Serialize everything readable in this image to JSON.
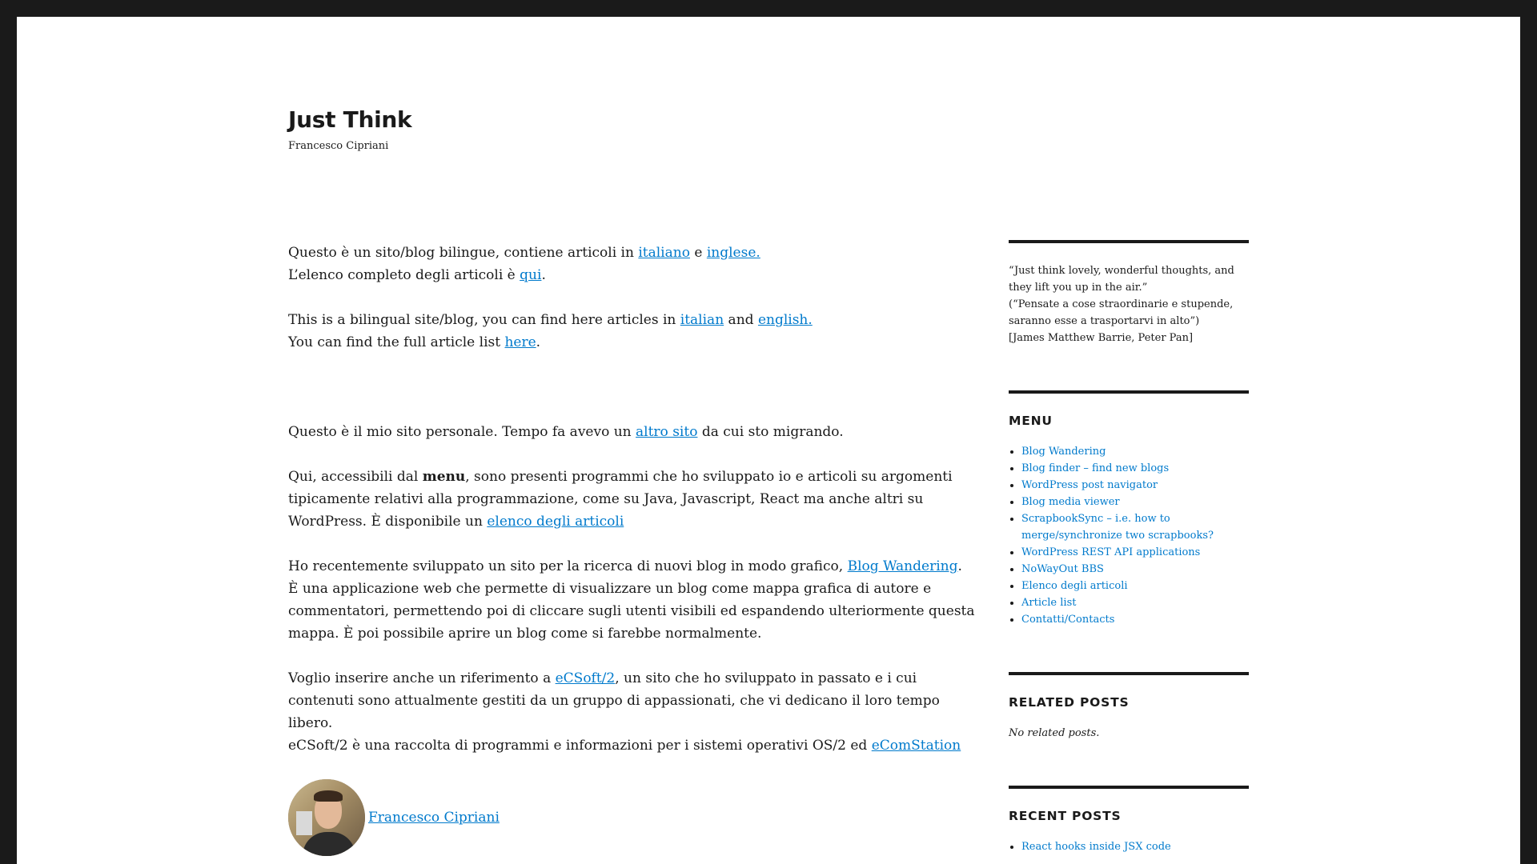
{
  "site": {
    "title": "Just Think",
    "description": "Francesco Cipriani"
  },
  "intro": {
    "it_line1_pre": "Questo è un sito/blog bilingue, contiene articoli in ",
    "it_link_italiano": "italiano",
    "it_line1_mid": " e ",
    "it_link_inglese": "inglese.",
    "it_line2_pre": "L’elenco completo degli articoli è  ",
    "it_link_qui": "qui",
    "it_line2_post": ".",
    "en_line1_pre": "This is a bilingual site/blog, you can find here articles in ",
    "en_link_italian": "italian",
    "en_line1_mid": " and ",
    "en_link_english": "english.",
    "en_line2_pre": "You can find the full article list ",
    "en_link_here": "here",
    "en_line2_post": "."
  },
  "body": {
    "p1_pre": "Questo è il mio sito personale. Tempo fa avevo un ",
    "p1_link": "altro sito",
    "p1_post": " da cui sto migrando.",
    "p2_pre": "Qui, accessibili dal ",
    "p2_bold": "menu",
    "p2_mid": ", sono presenti programmi che ho sviluppato io e articoli su argomenti tipicamente relativi alla programmazione, come su Java, Javascript, React ma anche altri su WordPress. È disponibile un ",
    "p2_link": "elenco degli articoli",
    "p3_pre": "Ho recentemente sviluppato un sito per la ricerca di nuovi blog in modo grafico, ",
    "p3_link": "Blog Wandering",
    "p3_post": ".",
    "p3_line2": "È una applicazione web che permette di visualizzare un blog come mappa grafica di autore e commentatori, permettendo poi di cliccare sugli utenti visibili ed espandendo ulteriormente questa mappa. È poi possibile aprire un blog come si farebbe normalmente.",
    "p4_pre": "Voglio inserire anche un  riferimento a ",
    "p4_link": "eCSoft/2",
    "p4_post": ", un sito che ho sviluppato in passato e i cui contenuti sono attualmente gestiti da un gruppo di appassionati, che vi dedicano il loro tempo libero.",
    "p4_line2_pre": "eCSoft/2 è una raccolta di programmi e informazioni per i sistemi operativi OS/2 ed ",
    "p4_line2_link": "eComStation",
    "author_name": "Francesco Cipriani"
  },
  "sidebar": {
    "quote_line1": "“Just think lovely, wonderful thoughts, and they lift you up in the air.”",
    "quote_line2": "(“Pensate a cose straordinarie e stupende, saranno esse a trasportarvi in alto”)",
    "quote_line3": "[James Matthew Barrie, Peter Pan]",
    "menu_title": "MENU",
    "menu_items": [
      "Blog Wandering",
      "Blog finder – find new blogs",
      "WordPress post navigator",
      "Blog media viewer",
      "ScrapbookSync – i.e. how to merge/synchronize two scrapbooks?",
      "WordPress REST API applications",
      "NoWayOut BBS",
      "Elenco degli articoli",
      "Article list",
      "Contatti/Contacts"
    ],
    "related_title": "RELATED POSTS",
    "related_empty": "No related posts.",
    "recent_title": "RECENT POSTS",
    "recent_items": [
      "React hooks inside JSX code"
    ]
  },
  "colors": {
    "frame": "#1a1a1a",
    "link": "#007acc",
    "text": "#1a1a1a",
    "background": "#ffffff"
  }
}
